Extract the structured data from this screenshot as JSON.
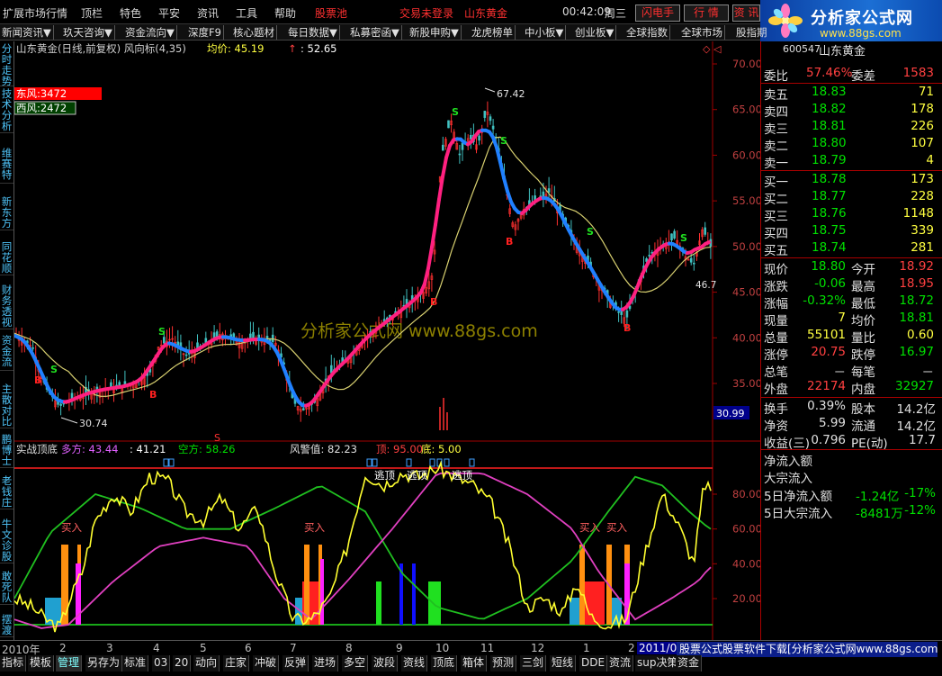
{
  "menu": {
    "items": [
      "扩展市场行情",
      "顶栏",
      "特色",
      "平安",
      "资讯",
      "工具",
      "帮助"
    ],
    "highlight": "股票池",
    "login_status": "交易未登录",
    "broker": "山东黄金",
    "time": "00:42:09",
    "weekday": "周三",
    "buttons": [
      "闪电手",
      "行  情",
      "资  讯"
    ]
  },
  "logo": {
    "title": "分析家公式网",
    "url": "www.88gs.com"
  },
  "toolbar2": [
    "新闻资讯▼",
    "玖天咨询▼",
    "资金流向▼",
    "深度F9",
    "核心题材",
    "每日数据▼",
    "私募密函▼",
    "新股申购▼",
    "龙虎榜单",
    "中小板▼",
    "创业板▼",
    "全球指数",
    "全球市场",
    "股指期"
  ],
  "left_tabs": [
    "分时走势",
    "技术分析",
    "维赛特",
    "新东方",
    "同花顺",
    "财务透视",
    "资金流",
    "主散对比",
    "鹏博士",
    "老钱庄",
    "牛文诊股",
    "敢死队",
    "摆渡"
  ],
  "chart_header": {
    "title": "山东黄金(日线,前复权) 风向标(4,35)",
    "avg_label": "均价: 45.19",
    "arrow": "↑",
    "value2": ": 52.65"
  },
  "legend_boxes": [
    "东风:3472",
    "西风:2472"
  ],
  "price_axis": [
    "70.00",
    "65.00",
    "60.00",
    "55.00",
    "50.00",
    "45.00",
    "40.00",
    "35.00"
  ],
  "price_labels": {
    "high": "67.42",
    "low": "30.74",
    "right": "46.7",
    "current": "30.99"
  },
  "signal_labels": {
    "buy": "B",
    "sell": "S",
    "watermark": "分析家公式网 www.88gs.com"
  },
  "indicator_header": {
    "name": "实战顶底",
    "duo": "多方: 43.44",
    "v2": ": 41.21",
    "kong": "空方: 58.26",
    "alert": "风警值: 82.23",
    "top": "顶: 95.00",
    "bottom": "底: 5.00"
  },
  "indicator_axis": [
    "80.00",
    "60.00",
    "40.00",
    "20.00"
  ],
  "indicator_labels": {
    "buy": "买入",
    "top": "逃顶"
  },
  "time_axis": [
    "2010年",
    "2",
    "3",
    "4",
    "5",
    "6",
    "7",
    "8",
    "9",
    "10",
    "11",
    "12",
    "1",
    "2",
    "2011/03"
  ],
  "bottom_tabs": [
    "指标",
    "模板",
    "管理",
    "另存为",
    "标准",
    "03",
    "20",
    "动向",
    "庄家",
    "冲破",
    "反弹",
    "进场",
    "多空",
    "波段",
    "资线",
    "顶底",
    "箱体",
    "预测",
    "三剑",
    "短线",
    "DDE",
    "资流",
    "sup决策",
    "资金"
  ],
  "ad_text": "股票公式股票软件下载[分析家公式网www.88gs.com]",
  "quote": {
    "code": "600547",
    "name": "山东黄金",
    "weibi": {
      "label": "委比",
      "value": "57.46%",
      "label2": "委差",
      "value2": "1583"
    },
    "asks": [
      {
        "label": "卖五",
        "price": "18.83",
        "vol": "71"
      },
      {
        "label": "卖四",
        "price": "18.82",
        "vol": "178"
      },
      {
        "label": "卖三",
        "price": "18.81",
        "vol": "226"
      },
      {
        "label": "卖二",
        "price": "18.80",
        "vol": "107"
      },
      {
        "label": "卖一",
        "price": "18.79",
        "vol": "4"
      }
    ],
    "bids": [
      {
        "label": "买一",
        "price": "18.78",
        "vol": "173"
      },
      {
        "label": "买二",
        "price": "18.77",
        "vol": "228"
      },
      {
        "label": "买三",
        "price": "18.76",
        "vol": "1148"
      },
      {
        "label": "买四",
        "price": "18.75",
        "vol": "339"
      },
      {
        "label": "买五",
        "price": "18.74",
        "vol": "281"
      }
    ],
    "stats": [
      {
        "l1": "现价",
        "v1": "18.80",
        "c1": "cg",
        "l2": "今开",
        "v2": "18.92",
        "c2": "cr"
      },
      {
        "l1": "涨跌",
        "v1": "-0.06",
        "c1": "cg",
        "l2": "最高",
        "v2": "18.95",
        "c2": "cr"
      },
      {
        "l1": "涨幅",
        "v1": "-0.32%",
        "c1": "cg",
        "l2": "最低",
        "v2": "18.72",
        "c2": "cg"
      },
      {
        "l1": "现量",
        "v1": "7",
        "c1": "cy",
        "l2": "均价",
        "v2": "18.81",
        "c2": "cg"
      },
      {
        "l1": "总量",
        "v1": "55101",
        "c1": "cy",
        "l2": "量比",
        "v2": "0.60",
        "c2": "cy"
      },
      {
        "l1": "涨停",
        "v1": "20.75",
        "c1": "cr",
        "l2": "跌停",
        "v2": "16.97",
        "c2": "cg"
      },
      {
        "l1": "总笔",
        "v1": "－",
        "c1": "cw",
        "l2": "每笔",
        "v2": "－",
        "c2": "cw"
      },
      {
        "l1": "外盘",
        "v1": "22174",
        "c1": "cr",
        "l2": "内盘",
        "v2": "32927",
        "c2": "cg"
      }
    ],
    "stats2": [
      {
        "l1": "换手",
        "v1": "0.39%",
        "l2": "股本",
        "v2": "14.2亿"
      },
      {
        "l1": "净资",
        "v1": "5.99",
        "l2": "流通",
        "v2": "14.2亿"
      },
      {
        "l1": "收益(三)",
        "v1": "0.796",
        "l2": "PE(动)",
        "v2": "17.7"
      }
    ],
    "flow_title": "净流入额",
    "flow_sub": "大宗流入",
    "flows": [
      {
        "label": "5日净流入额",
        "value": "-1.24亿",
        "pct": "-17%"
      },
      {
        "label": "5日大宗流入",
        "value": "-8481万",
        "pct": "-12%"
      }
    ]
  },
  "colors": {
    "up": "#ff4040",
    "down": "#00e000",
    "accent_blue": "#1e90ff",
    "pink": "#ff2080",
    "yellow": "#ffff40",
    "grid": "#800000"
  }
}
